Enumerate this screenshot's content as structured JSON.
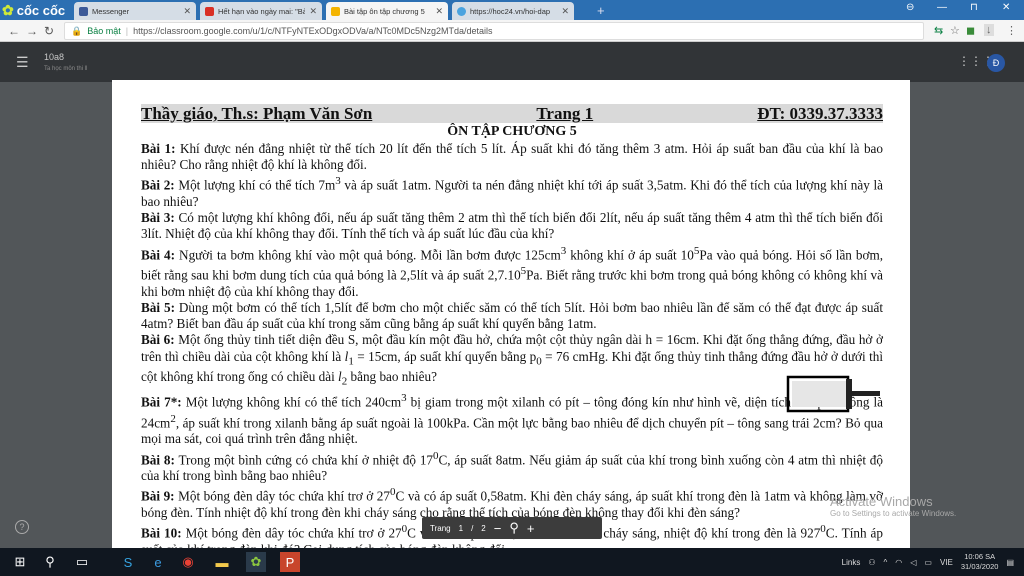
{
  "browser": {
    "logo": "cốc cốc",
    "tabs": [
      {
        "title": "Messenger",
        "color": "#3b5998"
      },
      {
        "title": "Hết hạn vào ngày mai: \"Bà",
        "color": "#d93025"
      },
      {
        "title": "Bài tập ôn tập chương 5",
        "color": "#f4b400"
      },
      {
        "title": "https://hoc24.vn/hoi-dap",
        "color": "#4aa3df"
      }
    ],
    "new_tab": "+",
    "win_min": "—",
    "win_max": "⊓",
    "win_close": "✕",
    "account": "⊖",
    "secure_label": "Bảo mật",
    "url": "https://classroom.google.com/u/1/c/NTFyNTExODgxODVa/a/NTc0MDc5Nzg2MTda/details"
  },
  "classroom": {
    "class_name": "10a8",
    "class_sub": "Ta học môn thi ll",
    "avatar": "Đ",
    "help": "?"
  },
  "document": {
    "header_left": "Thầy giáo, Th.s: Phạm Văn Sơn",
    "header_mid": "Trang 1",
    "header_right": "ĐT: 0339.37.3333",
    "title": "ÔN TẬP CHƯƠNG 5",
    "q1_label": "Bài 1:",
    "q1": "Khí được nén đẳng nhiệt từ thể tích 20 lít đến thể tích 5 lít. Áp suất khi đó tăng thêm 3 atm. Hỏi áp suất ban đầu của khí là bao nhiêu? Cho rằng nhiệt độ khí là không đổi.",
    "q2_label": "Bài 2:",
    "q2a": "Một lượng khí có thể tích 7m",
    "q2_sup": "3",
    "q2b": " và áp suất 1atm. Người ta nén đẳng nhiệt khí tới áp suất 3,5atm. Khi đó thể tích của lượng khí này là bao nhiêu?",
    "q3_label": "Bài 3:",
    "q3": "Có một lượng khí không đổi, nếu áp suất tăng thêm 2 atm thì thể tích biến đổi 2lít, nếu áp suất tăng thêm 4 atm thì thể tích biến đổi 3lít. Nhiệt độ của khí không thay đổi. Tính thể tích và áp suất lúc đầu của khí?",
    "q4_label": "Bài 4:",
    "q4a": "Người ta bơm không khí vào một quả bóng. Mỗi lần bơm được 125cm",
    "q4_sup1": "3",
    "q4b": " không khí ở áp suất 10",
    "q4_sup2": "5",
    "q4c": "Pa vào quả bóng. Hỏi số lần bơm, biết rằng sau khi bơm dung tích của quả bóng là 2,5lít và áp suất 2,7.10",
    "q4_sup3": "5",
    "q4d": "Pa. Biết rằng trước khi bơm trong quả bóng không có không khí và khi bơm nhiệt độ của khí không thay đổi.",
    "q5_label": "Bài 5:",
    "q5": "Dùng một bơm có thể tích 1,5lít để bơm cho một chiếc săm có thể tích 5lít. Hỏi bơm bao nhiêu lần để săm có thể đạt được áp suất 4atm? Biết ban đầu áp suất của khí trong săm cũng bằng áp suất khí quyển bằng 1atm.",
    "q6_label": "Bài 6:",
    "q6a": "Một ống thủy tinh tiết diện đều S, một đầu kín một đầu hở, chứa một cột thủy ngân dài h = 16cm. Khi đặt ống thẳng đứng, đầu hở ở trên thì chiều dài của cột không khí là ",
    "q6_l1": "l",
    "q6_l1sub": "1",
    "q6b": " = 15cm, áp suất khí quyển bằng p",
    "q6_p0sub": "0",
    "q6c": " = 76 cmHg. Khi đặt ống thủy tinh thẳng đứng đầu hở ở dưới thì cột không khí trong ống có chiều dài ",
    "q6_l2": "l",
    "q6_l2sub": "2",
    "q6d": " bằng bao nhiêu?",
    "q7_label": "Bài 7*:",
    "q7a": "Một lượng không khí có thể tích 240cm",
    "q7_sup1": "3",
    "q7b": " bị giam trong một xilanh có pít – tông đóng kín như hình vẽ, diện tích của pít – tông là 24cm",
    "q7_sup2": "2",
    "q7c": ", áp suất khí trong xilanh bằng áp suất ngoài là 100kPa. Cần một lực bằng bao nhiêu để dịch chuyển pít – tông sang trái 2cm? Bỏ qua mọi ma sát, coi quá trình trên đẳng nhiệt.",
    "q8_label": "Bài 8:",
    "q8a": "Trong một bình cứng có chứa khí ở nhiệt độ 17",
    "q8_sup": "0",
    "q8b": "C, áp suất 8atm. Nếu giảm áp suất của khí trong bình xuống còn 4 atm thì nhiệt độ của khí trong bình bằng bao nhiêu?",
    "q9_label": "Bài 9:",
    "q9a": "Một bóng đèn dây tóc chứa khí trơ ở 27",
    "q9_sup": "0",
    "q9b": "C và có áp suất 0,58atm. Khi đèn cháy sáng, áp suất khí trong đèn là 1atm và không làm vỡ bóng đèn. Tính nhiệt độ khí trong đèn khi cháy sáng cho rằng thể tích của bóng đèn không thay đổi khi đèn sáng?",
    "q10_label": "Bài 10:",
    "q10a": "Một bóng đèn dây tóc chứa khí trơ ở 27",
    "q10_sup1": "0",
    "q10b": "C và dưới áp suất 0,54atm. Khi đèn cháy sáng, nhiệt độ khí trong đèn là 927",
    "q10_sup2": "0",
    "q10c": "C. Tính áp suất của khí trong đèn khi đó? Coi dung tích của bóng đèn không đổi."
  },
  "pdf_controls": {
    "page_label": "Trang",
    "page": "1",
    "slash": "/",
    "total": "2",
    "minus": "−",
    "zoom": "⚲",
    "plus": "+"
  },
  "watermark": {
    "line1": "Activate Windows",
    "line2": "Go to Settings to activate Windows."
  },
  "taskbar": {
    "links": "Links",
    "lang": "VIE",
    "time": "10:06 SA",
    "date": "31/03/2020"
  }
}
